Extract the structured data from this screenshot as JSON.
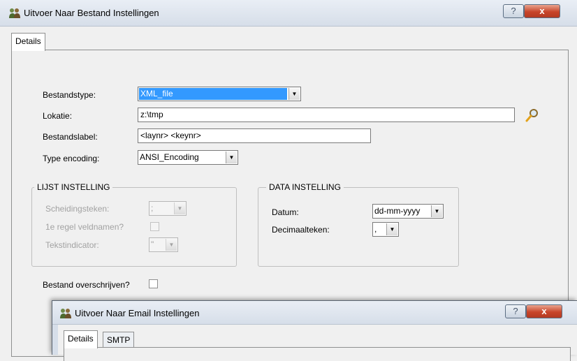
{
  "window": {
    "title": "Uitvoer Naar Bestand Instellingen",
    "help_label": "?",
    "close_label": "x",
    "tabs": [
      {
        "label": "Details"
      }
    ]
  },
  "form": {
    "bestandstype": {
      "label": "Bestandstype:",
      "value": "XML_file"
    },
    "lokatie": {
      "label": "Lokatie:",
      "value": "z:\\tmp"
    },
    "bestandslabel": {
      "label": "Bestandslabel:",
      "value": "<laynr> <keynr>"
    },
    "encoding": {
      "label": "Type encoding:",
      "value": "ANSI_Encoding"
    },
    "overwrite_label": "Bestand overschrijven?"
  },
  "lijst": {
    "title": "LIJST INSTELLING",
    "scheidingsteken": {
      "label": "Scheidingsteken:",
      "value": ";"
    },
    "veldnamen_label": "1e regel veldnamen?",
    "tekstindicator": {
      "label": "Tekstindicator:",
      "value": "\""
    }
  },
  "data_instelling": {
    "title": "DATA INSTELLING",
    "datum": {
      "label": "Datum:",
      "value": "dd-mm-yyyy"
    },
    "decimaal": {
      "label": "Decimaalteken:",
      "value": ","
    }
  },
  "window2": {
    "title": "Uitvoer Naar Email Instellingen",
    "help_label": "?",
    "close_label": "x",
    "tabs": [
      {
        "label": "Details"
      },
      {
        "label": "SMTP"
      }
    ]
  },
  "colors": {
    "accent": "#3399ff",
    "close": "#c8452a",
    "search": "#e3a21a"
  },
  "icons": {
    "app": "users-icon",
    "browse": "magnifier-icon",
    "dropdown": "chevron-down-icon"
  }
}
